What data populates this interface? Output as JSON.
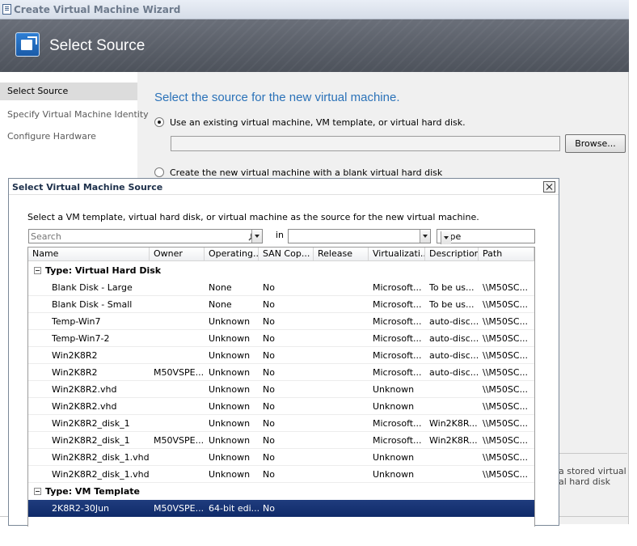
{
  "window": {
    "title": "Create Virtual Machine Wizard"
  },
  "header": {
    "title": "Select Source",
    "icon": "vm-source-icon"
  },
  "nav": {
    "items": [
      {
        "label": "Select Source",
        "active": true
      },
      {
        "label": "Specify Virtual Machine Identity",
        "active": false
      },
      {
        "label": "Configure Hardware",
        "active": false
      }
    ]
  },
  "main": {
    "heading": "Select the source for the new virtual machine.",
    "option_existing": "Use an existing virtual machine, VM template, or virtual hard disk.",
    "path_value": "",
    "browse_label": "Browse...",
    "option_blank": "Create the new virtual machine with a blank virtual hard disk",
    "hint_line1": "a stored virtual",
    "hint_line2": "al hard disk"
  },
  "dialog": {
    "title": "Select Virtual Machine Source",
    "instruction": "Select a VM template, virtual hard disk, or virtual machine as the source for the new virtual machine.",
    "search_placeholder": "Search",
    "in_label": "in",
    "in_value": "",
    "type_value": "Type",
    "columns": [
      "Name",
      "Owner",
      "Operating...",
      "SAN Cop...",
      "Release",
      "Virtualizati...",
      "Description",
      "Path"
    ],
    "groups": [
      {
        "label": "Type: Virtual Hard Disk",
        "rows": [
          [
            "Blank Disk - Large",
            "",
            "None",
            "No",
            "",
            "Microsoft...",
            "To be us...",
            "\\\\M50SC..."
          ],
          [
            "Blank Disk - Small",
            "",
            "None",
            "No",
            "",
            "Microsoft...",
            "To be us...",
            "\\\\M50SC..."
          ],
          [
            "Temp-Win7",
            "",
            "Unknown",
            "No",
            "",
            "Microsoft...",
            "auto-disc...",
            "\\\\M50SC..."
          ],
          [
            "Temp-Win7-2",
            "",
            "Unknown",
            "No",
            "",
            "Microsoft...",
            "auto-disc...",
            "\\\\M50SC..."
          ],
          [
            "Win2K8R2",
            "",
            "Unknown",
            "No",
            "",
            "Microsoft...",
            "auto-disc...",
            "\\\\M50SC..."
          ],
          [
            "Win2K8R2",
            "M50VSPE...",
            "Unknown",
            "No",
            "",
            "Microsoft...",
            "auto-disc...",
            "\\\\M50SC..."
          ],
          [
            "Win2K8R2.vhd",
            "",
            "Unknown",
            "No",
            "",
            "Unknown",
            "",
            "\\\\M50SC..."
          ],
          [
            "Win2K8R2.vhd",
            "",
            "Unknown",
            "No",
            "",
            "Unknown",
            "",
            "\\\\M50SC..."
          ],
          [
            "Win2K8R2_disk_1",
            "",
            "Unknown",
            "No",
            "",
            "Microsoft...",
            "Win2K8R...",
            "\\\\M50SC..."
          ],
          [
            "Win2K8R2_disk_1",
            "M50VSPE...",
            "Unknown",
            "No",
            "",
            "Microsoft...",
            "Win2K8R...",
            "\\\\M50SC..."
          ],
          [
            "Win2K8R2_disk_1.vhd",
            "",
            "Unknown",
            "No",
            "",
            "Unknown",
            "",
            "\\\\M50SC..."
          ],
          [
            "Win2K8R2_disk_1.vhd",
            "",
            "Unknown",
            "No",
            "",
            "Unknown",
            "",
            "\\\\M50SC..."
          ]
        ]
      },
      {
        "label": "Type: VM Template",
        "rows": [
          [
            "2K8R2-30Jun",
            "M50VSPE...",
            "64-bit edi...",
            "No",
            "",
            "",
            "",
            ""
          ]
        ],
        "selected_row": 0
      }
    ]
  },
  "colors": {
    "heading": "#2b72b8",
    "selection": "#0f2a68",
    "header_bg": "#4d525b"
  }
}
